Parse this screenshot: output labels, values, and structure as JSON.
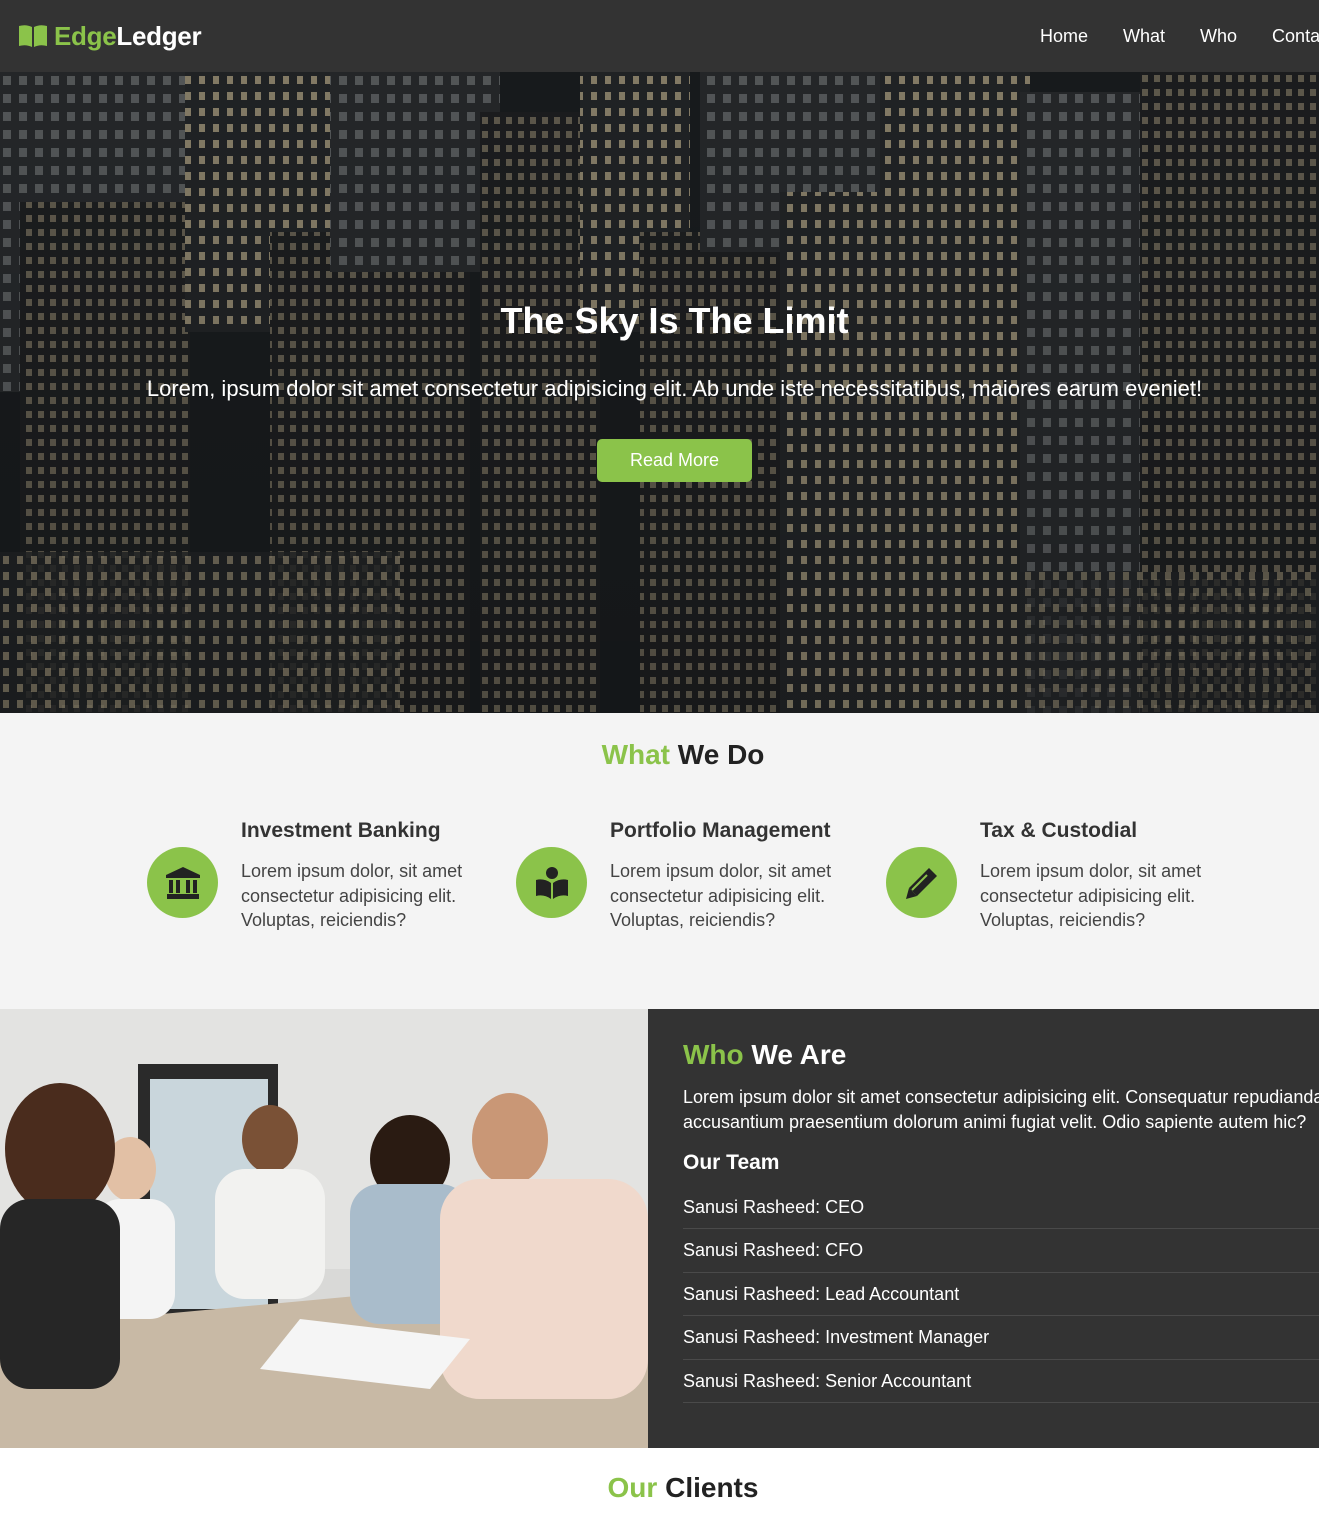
{
  "brand": {
    "part1": "Edge",
    "part2": "Ledger",
    "icon": "book-open-icon"
  },
  "nav": {
    "items": [
      "Home",
      "What",
      "Who",
      "Contac"
    ]
  },
  "hero": {
    "title": "The Sky Is The Limit",
    "subtitle": "Lorem, ipsum dolor sit amet consectetur adipisicing elit. Ab unde iste necessitatibus, maiores earum eveniet!",
    "button": "Read More"
  },
  "what": {
    "title_accent": "What",
    "title_rest": " We Do",
    "services": [
      {
        "icon": "bank-icon",
        "title": "Investment Banking",
        "text": "Lorem ipsum dolor, sit amet consectetur adipisicing elit. Voluptas, reiciendis?"
      },
      {
        "icon": "reading-book-icon",
        "title": "Portfolio Management",
        "text": "Lorem ipsum dolor, sit amet consectetur adipisicing elit. Voluptas, reiciendis?"
      },
      {
        "icon": "pencil-icon",
        "title": "Tax & Custodial",
        "text": "Lorem ipsum dolor, sit amet consectetur adipisicing elit. Voluptas, reiciendis?"
      }
    ]
  },
  "who": {
    "title_accent": "Who",
    "title_rest": " We Are",
    "text": "Lorem ipsum dolor sit amet consectetur adipisicing elit. Consequatur repudiandae accusantium praesentium dolorum animi fugiat velit. Odio sapiente autem hic?",
    "team_title": "Our Team",
    "team": [
      "Sanusi Rasheed: CEO",
      "Sanusi Rasheed: CFO",
      "Sanusi Rasheed: Lead Accountant",
      "Sanusi Rasheed: Investment Manager",
      "Sanusi Rasheed: Senior Accountant"
    ]
  },
  "clients": {
    "title_accent": "Our",
    "title_rest": " Clients"
  },
  "colors": {
    "accent": "#8bc34a",
    "dark": "#333333",
    "light": "#f4f4f4"
  }
}
